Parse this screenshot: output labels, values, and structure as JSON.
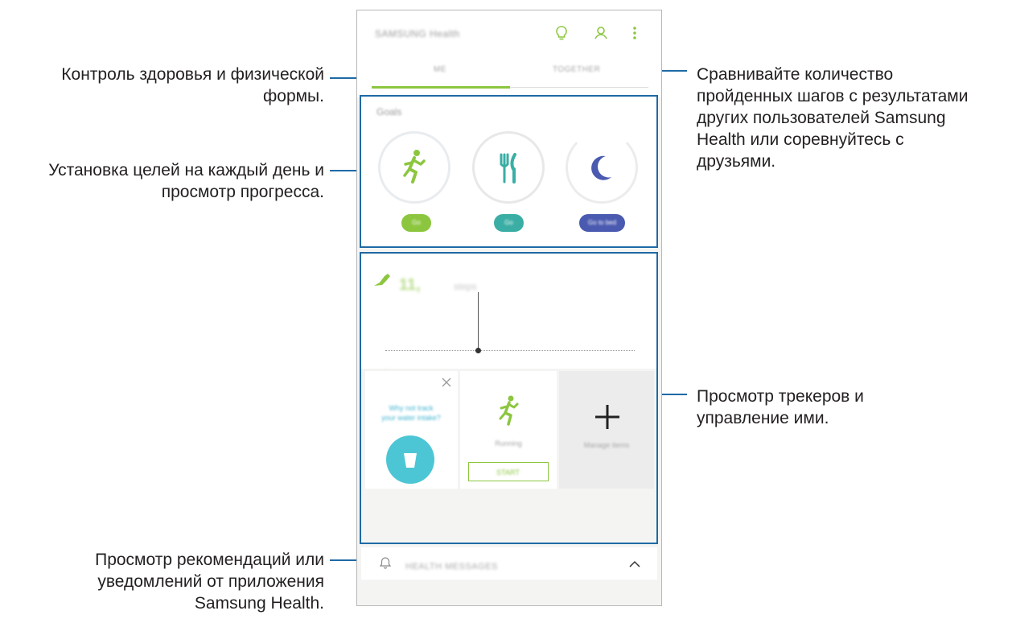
{
  "callouts": {
    "health": [
      "Контроль здоровья и физической",
      "формы."
    ],
    "goals": [
      "Установка целей на каждый день и",
      "просмотр прогресса."
    ],
    "messages": [
      "Просмотр рекомендаций или",
      "уведомлений от приложения",
      "Samsung Health."
    ],
    "together": [
      "Сравнивайте количество",
      "пройденных шагов с результатами",
      "других пользователей Samsung",
      "Health или соревнуйтесь с",
      "друзьями."
    ],
    "trackers": [
      "Просмотр трекеров и",
      "управление ими."
    ]
  },
  "phone": {
    "app_title": "SAMSUNG Health",
    "tabs": [
      "ME",
      "TOGETHER"
    ],
    "goals_title": "Goals",
    "goal_buttons": [
      "Go",
      "Go",
      "Go to bed"
    ],
    "steps_value": "11,",
    "steps_unit": "steps",
    "tracker_tip": [
      "Why not track",
      "your water intake?"
    ],
    "tracker_name": "Running",
    "tracker_button": "START",
    "manage_items": "Manage items",
    "messages_label": "HEALTH MESSAGES"
  },
  "colors": {
    "callout_line": "#1f6aa5",
    "accent_green": "#8cc63f",
    "teal": "#3aaea4",
    "indigo": "#4a5ab0",
    "water": "#4cc6d4"
  },
  "icons": [
    "lightbulb-icon",
    "profile-icon",
    "more-options-icon",
    "runner-icon",
    "fork-knife-icon",
    "moon-icon",
    "shoe-icon",
    "close-icon",
    "water-cup-icon",
    "plus-icon",
    "bell-icon",
    "chevron-up-icon"
  ]
}
